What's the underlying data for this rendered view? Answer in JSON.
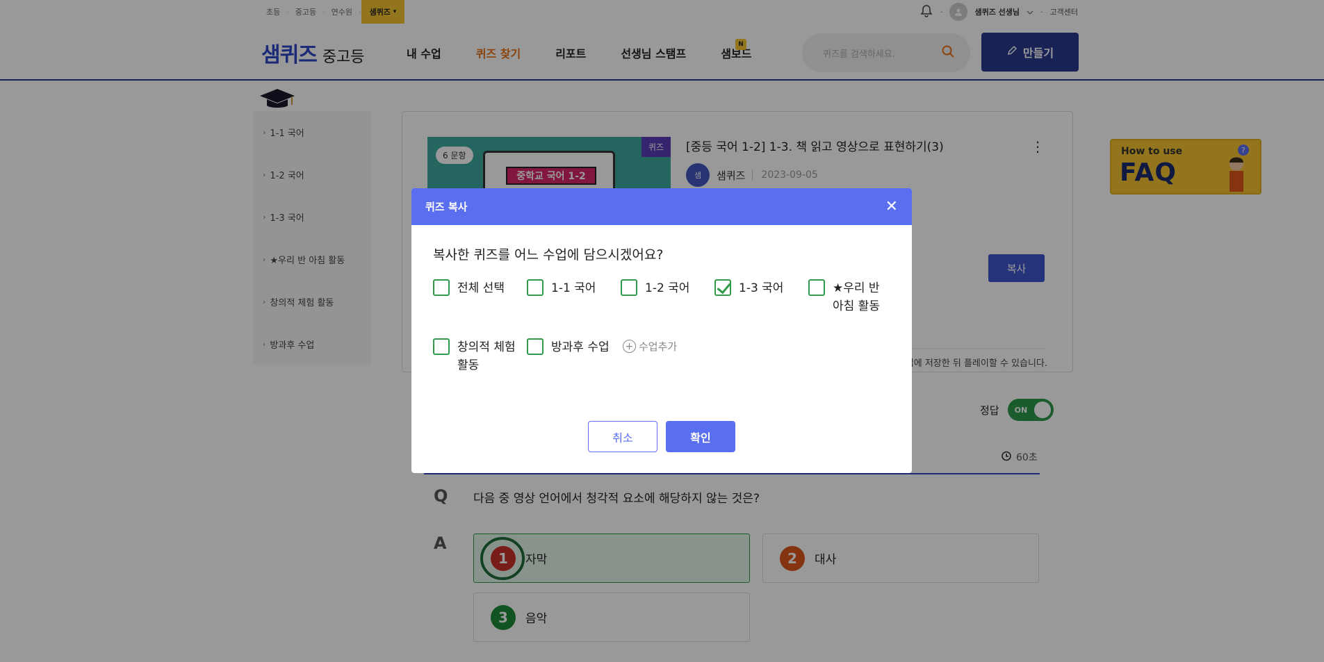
{
  "util": {
    "links": [
      "초등",
      "중고등",
      "연수원"
    ],
    "active": "샘퀴즈",
    "active_caret": "▾",
    "user": "샘퀴즈 선생님",
    "support": "고객센터"
  },
  "header": {
    "logo": "샘퀴즈",
    "logo_sub": "중고등",
    "nav": [
      "내 수업",
      "퀴즈 찾기",
      "리포트",
      "선생님 스탬프",
      "샘보드"
    ],
    "nav_active_index": 1,
    "new_badge": "N",
    "search_placeholder": "퀴즈를 검색하세요.",
    "make_label": "만들기"
  },
  "sidebar": {
    "items": [
      "1-1 국어",
      "1-2 국어",
      "1-3 국어",
      "★우리 반 아침 활동",
      "창의적 체험 활동",
      "방과후 수업"
    ]
  },
  "card": {
    "question_count": "6 문항",
    "kind": "퀴즈",
    "book_title": "중학교 국어 1-2",
    "title": "[중등 국어 1-2] 1-3. 책 읽고 영상으로 표현하기(3)",
    "author_avatar": "샘",
    "author": "샘퀴즈",
    "date": "2023-09-05",
    "copy_label": "복사",
    "notice": "업에 저장한 뒤 플레이할 수 있습니다."
  },
  "quiz": {
    "answer_label": "정답",
    "toggle": "ON",
    "timer": "60초",
    "q_marker": "Q",
    "a_marker": "A",
    "question": "다음 중 영상 언어에서 청각적 요소에 해당하지 않는 것은?",
    "options": [
      {
        "num": "1",
        "text": "자막",
        "color": "#c8302a"
      },
      {
        "num": "2",
        "text": "대사",
        "color": "#e0561a"
      },
      {
        "num": "3",
        "text": "음악",
        "color": "#1f8a3a"
      }
    ]
  },
  "faq": {
    "line1": "How to use",
    "line2": "FAQ"
  },
  "modal": {
    "title": "퀴즈 복사",
    "question": "복사한 퀴즈를 어느 수업에 담으시겠어요?",
    "options": [
      {
        "label": "전체 선택",
        "checked": false
      },
      {
        "label": "1-1 국어",
        "checked": false
      },
      {
        "label": "1-2 국어",
        "checked": false
      },
      {
        "label": "1-3 국어",
        "checked": true
      },
      {
        "label": "★우리 반 아침 활동",
        "checked": false
      },
      {
        "label": "창의적 체험 활동",
        "checked": false
      },
      {
        "label": "방과후 수업",
        "checked": false
      }
    ],
    "add_class": "수업추가",
    "cancel": "취소",
    "confirm": "확인"
  },
  "colors": {
    "accent": "#5a6ef0",
    "navy": "#2a3a8c",
    "check": "#2e9a4a"
  }
}
